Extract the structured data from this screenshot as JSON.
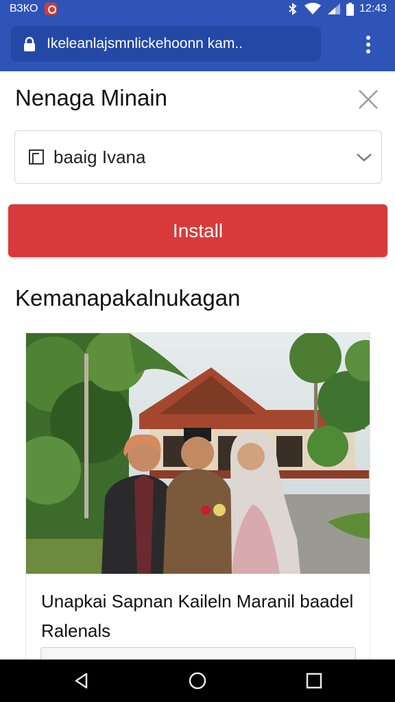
{
  "status_bar": {
    "left_text": "ВЗКО",
    "time": "12:43",
    "icons": [
      "notification-icon",
      "bluetooth-icon",
      "wifi-icon",
      "signal-icon",
      "battery-icon"
    ]
  },
  "browser": {
    "url": "Ikeleanlajsmnlickehoonn kam..",
    "lock_icon": "lock-icon",
    "menu_icon": "more-vert-icon"
  },
  "dialog": {
    "title": "Nenaga Minain",
    "close_icon": "close-icon",
    "select_value": "baaig Ivana",
    "select_icon": "document-icon",
    "install_label": "Install"
  },
  "section": {
    "heading": "Kemanapakalnukagan"
  },
  "card": {
    "title": "Unapkai Sapnan Kaileln Maranil baadel Ralenals"
  },
  "colors": {
    "status_bar": "#2f54b8",
    "url_box": "#2448a6",
    "install_button": "#d83a3a",
    "nav_bar": "#000000"
  },
  "nav_bar": {
    "icons": [
      "back-icon",
      "home-icon",
      "recents-icon"
    ]
  }
}
